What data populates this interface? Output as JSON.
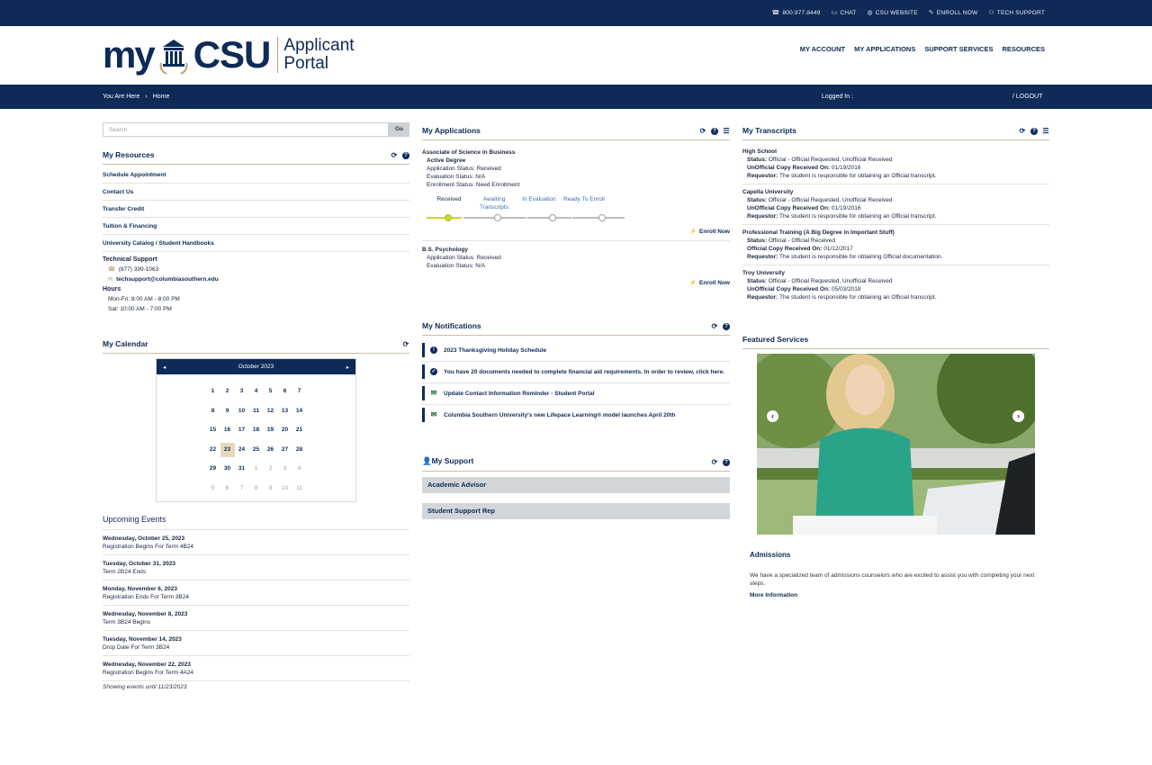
{
  "topbar": {
    "phone": "800.977.8449",
    "chat": "CHAT",
    "website": "CSU WEBSITE",
    "enroll": "ENROLL NOW",
    "tech": "TECH SUPPORT"
  },
  "logo": {
    "my": "my",
    "csu": "CSU",
    "line1": "Applicant",
    "line2": "Portal"
  },
  "nav": [
    "MY ACCOUNT",
    "MY APPLICATIONS",
    "SUPPORT SERVICES",
    "RESOURCES"
  ],
  "breadcrumb": {
    "label": "You Are Here",
    "home": "Home",
    "logged_in": "Logged In :",
    "logout": "LOGOUT"
  },
  "search": {
    "placeholder": "Search",
    "go": "Go"
  },
  "resources": {
    "title": "My Resources",
    "items": [
      "Schedule Appointment",
      "Contact Us",
      "Transfer Credit",
      "Tuition & Financing",
      "University Catalog / Student Handbooks"
    ],
    "tech_title": "Technical Support",
    "phone": "(877) 399-1063",
    "email": "techsupport@columbiasouthern.edu",
    "hours_title": "Hours",
    "hours1": "Mon-Fri: 8:00 AM - 8:00 PM",
    "hours2": "Sat: 10:00 AM - 7:00 PM"
  },
  "calendar": {
    "title": "My Calendar",
    "month": "October 2023",
    "days": [
      [
        "1",
        "2",
        "3",
        "4",
        "5",
        "6",
        "7"
      ],
      [
        "8",
        "9",
        "10",
        "11",
        "12",
        "13",
        "14"
      ],
      [
        "15",
        "16",
        "17",
        "18",
        "19",
        "20",
        "21"
      ],
      [
        "22",
        "23",
        "24",
        "25",
        "26",
        "27",
        "28"
      ],
      [
        "29",
        "30",
        "31",
        "1",
        "2",
        "3",
        "4"
      ],
      [
        "5",
        "6",
        "7",
        "8",
        "9",
        "10",
        "11"
      ]
    ],
    "today": "23"
  },
  "events": {
    "title": "Upcoming Events",
    "items": [
      {
        "date": "Wednesday, October 25, 2023",
        "desc": "Registration Begins For Term 4B24"
      },
      {
        "date": "Tuesday, October 31, 2023",
        "desc": "Term 2B24 Ends"
      },
      {
        "date": "Monday, November 6, 2023",
        "desc": "Registration Ends For Term 3B24"
      },
      {
        "date": "Wednesday, November 8, 2023",
        "desc": "Term 3B24 Begins"
      },
      {
        "date": "Tuesday, November 14, 2023",
        "desc": "Drop Date For Term 3B24"
      },
      {
        "date": "Wednesday, November 22, 2023",
        "desc": "Registration Begins For Term 4A24"
      }
    ],
    "note": "Showing events until 11/23/2023"
  },
  "applications": {
    "title": "My Applications",
    "app1": {
      "name": "Associate of Science in Business",
      "status": "Active Degree",
      "app_status": "Application Status: Received",
      "eval_status": "Evaluation Status: N/A",
      "enroll_status": "Enrollment Status: Need Enrollment",
      "steps": [
        "Received",
        "Awaiting Transcripts",
        "In Evaluation",
        "Ready To Enroll"
      ]
    },
    "app2": {
      "name": "B.S. Psychology",
      "app_status": "Application Status: Received",
      "eval_status": "Evaluation Status: N/A"
    },
    "enroll_label": "Enroll Now"
  },
  "notifications": {
    "title": "My Notifications",
    "items": [
      "2023 Thanksgiving Holiday Schedule",
      "You have 20 documents needed to complete financial aid requirements. In order to review, click here.",
      "Update Contact Information Reminder - Student Portal",
      "Columbia Southern University's new Lifepace Learning® model launches April 20th"
    ]
  },
  "support": {
    "title": "My Support",
    "items": [
      "Academic Advisor",
      "Student Support Rep"
    ]
  },
  "transcripts": {
    "title": "My Transcripts",
    "items": [
      {
        "school": "High School",
        "status": "Official - Official Requested, Unofficial Received",
        "copy_label": "UnOfficial Copy Received On:",
        "copy_date": "01/19/2016",
        "req": "The student is responsible for obtaining an Official transcript."
      },
      {
        "school": "Capella University",
        "status": "Official - Official Requested, Unofficial Received",
        "copy_label": "UnOfficial Copy Received On:",
        "copy_date": "01/19/2016",
        "req": "The student is responsible for obtaining an Official transcript."
      },
      {
        "school": "Professional Training (A Big Degree in Important Stuff)",
        "status": "Official - Official Received",
        "copy_label": "Official Copy Received On:",
        "copy_date": "01/12/2017",
        "req": "The student is responsible for obtaining Official documentation."
      },
      {
        "school": "Troy University",
        "status": "Official - Official Requested, Unofficial Received",
        "copy_label": "UnOfficial Copy Received On:",
        "copy_date": "05/03/2018",
        "req": "The student is responsible for obtaining an Official transcript."
      }
    ],
    "status_label": "Status:",
    "req_label": "Requestor:"
  },
  "featured": {
    "title": "Featured Services",
    "caption": "Admissions",
    "desc": "We have a specialized team of admissions counselors who are excited to assist you with completing your next steps.",
    "more": "More Information"
  }
}
